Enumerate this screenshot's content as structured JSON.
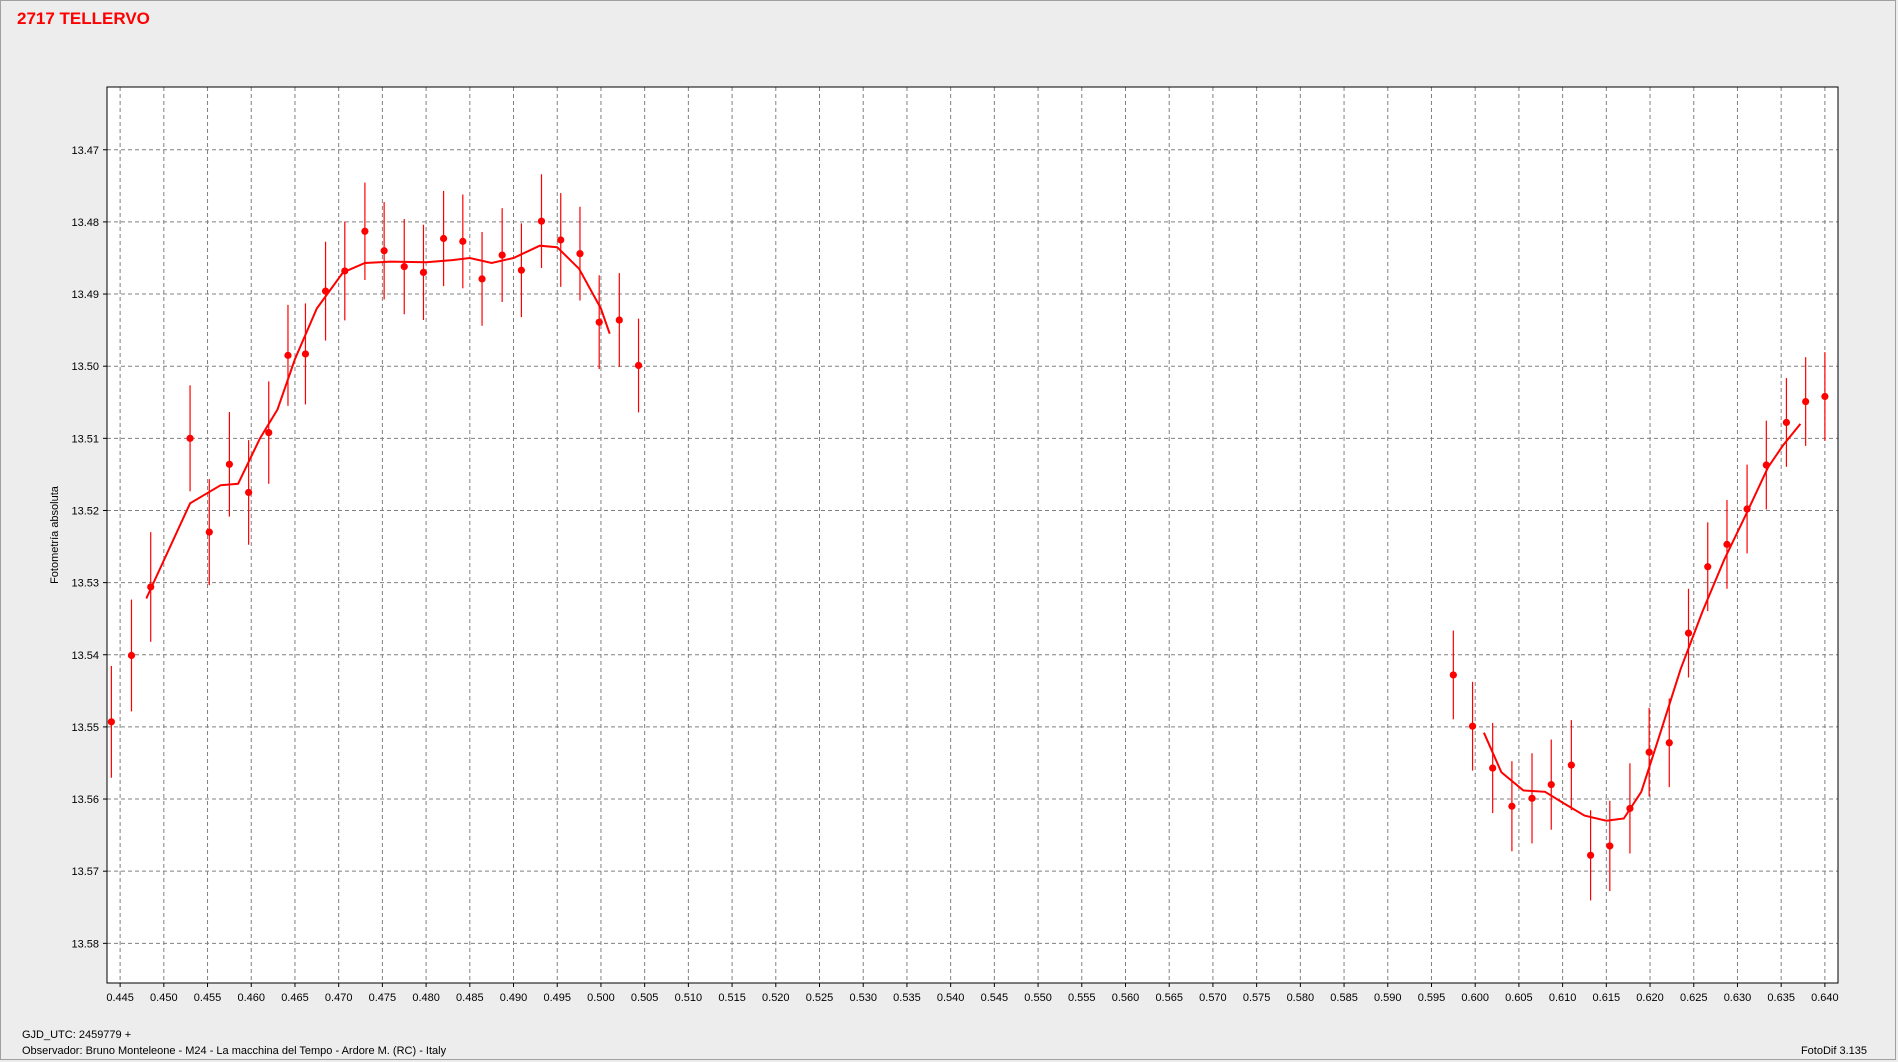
{
  "title": "2717 TELLERVO",
  "footer": {
    "gjd": "GJD_UTC: 2459779 +",
    "observer": "Observador: Bruno Monteleone - M24 - La macchina del Tempo - Ardore M. (RC) - Italy",
    "software": "FotoDif 3.135"
  },
  "colors": {
    "data": "#ff0000",
    "grid": "#808080",
    "background": "#ffffff",
    "window": "#ededed"
  },
  "chart_data": {
    "type": "scatter",
    "title": "2717 TELLERVO",
    "xlabel": "",
    "ylabel": "Fotometría absoluta",
    "xlim": [
      0.4435,
      0.6415
    ],
    "ylim": [
      13.4613,
      13.5855
    ],
    "y_inverted": true,
    "grid": true,
    "x_ticks": [
      "0.445",
      "0.450",
      "0.455",
      "0.460",
      "0.465",
      "0.470",
      "0.475",
      "0.480",
      "0.485",
      "0.490",
      "0.495",
      "0.500",
      "0.505",
      "0.510",
      "0.515",
      "0.520",
      "0.525",
      "0.530",
      "0.535",
      "0.540",
      "0.545",
      "0.550",
      "0.555",
      "0.560",
      "0.565",
      "0.570",
      "0.575",
      "0.580",
      "0.585",
      "0.590",
      "0.595",
      "0.600",
      "0.605",
      "0.610",
      "0.615",
      "0.620",
      "0.625",
      "0.630",
      "0.635",
      "0.640"
    ],
    "y_ticks": [
      "13.47",
      "13.48",
      "13.49",
      "13.50",
      "13.51",
      "13.52",
      "13.53",
      "13.54",
      "13.55",
      "13.56",
      "13.57",
      "13.58"
    ],
    "series": [
      {
        "type": "scatter-errorbar",
        "points": [
          {
            "x": 0.444,
            "y": 13.5493,
            "err": 0.0155
          },
          {
            "x": 0.4463,
            "y": 13.5401,
            "err": 0.0155
          },
          {
            "x": 0.4485,
            "y": 13.5306,
            "err": 0.0152
          },
          {
            "x": 0.453,
            "y": 13.51,
            "err": 0.0147
          },
          {
            "x": 0.4552,
            "y": 13.523,
            "err": 0.0147
          },
          {
            "x": 0.4575,
            "y": 13.5136,
            "err": 0.0145
          },
          {
            "x": 0.4597,
            "y": 13.5175,
            "err": 0.0145
          },
          {
            "x": 0.462,
            "y": 13.5092,
            "err": 0.0142
          },
          {
            "x": 0.4642,
            "y": 13.4985,
            "err": 0.014
          },
          {
            "x": 0.4662,
            "y": 13.4983,
            "err": 0.014
          },
          {
            "x": 0.4685,
            "y": 13.4896,
            "err": 0.0137
          },
          {
            "x": 0.4707,
            "y": 13.4868,
            "err": 0.0137
          },
          {
            "x": 0.473,
            "y": 13.4813,
            "err": 0.0135
          },
          {
            "x": 0.4752,
            "y": 13.484,
            "err": 0.0135
          },
          {
            "x": 0.4775,
            "y": 13.4862,
            "err": 0.0132
          },
          {
            "x": 0.4797,
            "y": 13.487,
            "err": 0.0132
          },
          {
            "x": 0.482,
            "y": 13.4823,
            "err": 0.0132
          },
          {
            "x": 0.4842,
            "y": 13.4827,
            "err": 0.013
          },
          {
            "x": 0.4864,
            "y": 13.4879,
            "err": 0.013
          },
          {
            "x": 0.4887,
            "y": 13.4846,
            "err": 0.013
          },
          {
            "x": 0.4909,
            "y": 13.4867,
            "err": 0.013
          },
          {
            "x": 0.4932,
            "y": 13.4799,
            "err": 0.013
          },
          {
            "x": 0.4954,
            "y": 13.4825,
            "err": 0.013
          },
          {
            "x": 0.4976,
            "y": 13.4844,
            "err": 0.013
          },
          {
            "x": 0.4998,
            "y": 13.4939,
            "err": 0.013
          },
          {
            "x": 0.5021,
            "y": 13.4936,
            "err": 0.013
          },
          {
            "x": 0.5043,
            "y": 13.4999,
            "err": 0.013
          },
          {
            "x": 0.5975,
            "y": 13.5428,
            "err": 0.0123
          },
          {
            "x": 0.5997,
            "y": 13.5499,
            "err": 0.0123
          },
          {
            "x": 0.602,
            "y": 13.5557,
            "err": 0.0125
          },
          {
            "x": 0.6042,
            "y": 13.561,
            "err": 0.0125
          },
          {
            "x": 0.6065,
            "y": 13.5599,
            "err": 0.0125
          },
          {
            "x": 0.6087,
            "y": 13.558,
            "err": 0.0125
          },
          {
            "x": 0.611,
            "y": 13.5553,
            "err": 0.0125
          },
          {
            "x": 0.6132,
            "y": 13.5678,
            "err": 0.0125
          },
          {
            "x": 0.6154,
            "y": 13.5665,
            "err": 0.0125
          },
          {
            "x": 0.6177,
            "y": 13.5613,
            "err": 0.0125
          },
          {
            "x": 0.6199,
            "y": 13.5535,
            "err": 0.0123
          },
          {
            "x": 0.6222,
            "y": 13.5522,
            "err": 0.0123
          },
          {
            "x": 0.6244,
            "y": 13.537,
            "err": 0.0123
          },
          {
            "x": 0.6266,
            "y": 13.5278,
            "err": 0.0123
          },
          {
            "x": 0.6288,
            "y": 13.5247,
            "err": 0.0123
          },
          {
            "x": 0.6311,
            "y": 13.5198,
            "err": 0.0123
          },
          {
            "x": 0.6333,
            "y": 13.5137,
            "err": 0.0123
          },
          {
            "x": 0.6356,
            "y": 13.5078,
            "err": 0.0123
          },
          {
            "x": 0.6378,
            "y": 13.5049,
            "err": 0.0123
          },
          {
            "x": 0.64,
            "y": 13.5042,
            "err": 0.0123
          }
        ]
      },
      {
        "type": "line",
        "segments": [
          [
            {
              "x": 0.448,
              "y": 13.5322
            },
            {
              "x": 0.453,
              "y": 13.519
            },
            {
              "x": 0.4565,
              "y": 13.5165
            },
            {
              "x": 0.4585,
              "y": 13.5163
            },
            {
              "x": 0.461,
              "y": 13.51
            },
            {
              "x": 0.463,
              "y": 13.506
            },
            {
              "x": 0.465,
              "y": 13.499
            },
            {
              "x": 0.4675,
              "y": 13.492
            },
            {
              "x": 0.4705,
              "y": 13.487
            },
            {
              "x": 0.473,
              "y": 13.4857
            },
            {
              "x": 0.476,
              "y": 13.4855
            },
            {
              "x": 0.48,
              "y": 13.4856
            },
            {
              "x": 0.483,
              "y": 13.4853
            },
            {
              "x": 0.485,
              "y": 13.485
            },
            {
              "x": 0.4875,
              "y": 13.4857
            },
            {
              "x": 0.49,
              "y": 13.485
            },
            {
              "x": 0.493,
              "y": 13.4833
            },
            {
              "x": 0.495,
              "y": 13.4835
            },
            {
              "x": 0.4975,
              "y": 13.4865
            },
            {
              "x": 0.5,
              "y": 13.492
            },
            {
              "x": 0.501,
              "y": 13.4955
            }
          ],
          [
            {
              "x": 0.601,
              "y": 13.5508
            },
            {
              "x": 0.603,
              "y": 13.5563
            },
            {
              "x": 0.6055,
              "y": 13.5588
            },
            {
              "x": 0.608,
              "y": 13.559
            },
            {
              "x": 0.61,
              "y": 13.5605
            },
            {
              "x": 0.6125,
              "y": 13.5623
            },
            {
              "x": 0.615,
              "y": 13.563
            },
            {
              "x": 0.617,
              "y": 13.5627
            },
            {
              "x": 0.619,
              "y": 13.559
            },
            {
              "x": 0.621,
              "y": 13.5515
            },
            {
              "x": 0.6235,
              "y": 13.542
            },
            {
              "x": 0.626,
              "y": 13.534
            },
            {
              "x": 0.6285,
              "y": 13.5268
            },
            {
              "x": 0.631,
              "y": 13.5205
            },
            {
              "x": 0.6335,
              "y": 13.514
            },
            {
              "x": 0.6352,
              "y": 13.511
            },
            {
              "x": 0.6372,
              "y": 13.508
            }
          ]
        ]
      }
    ]
  }
}
